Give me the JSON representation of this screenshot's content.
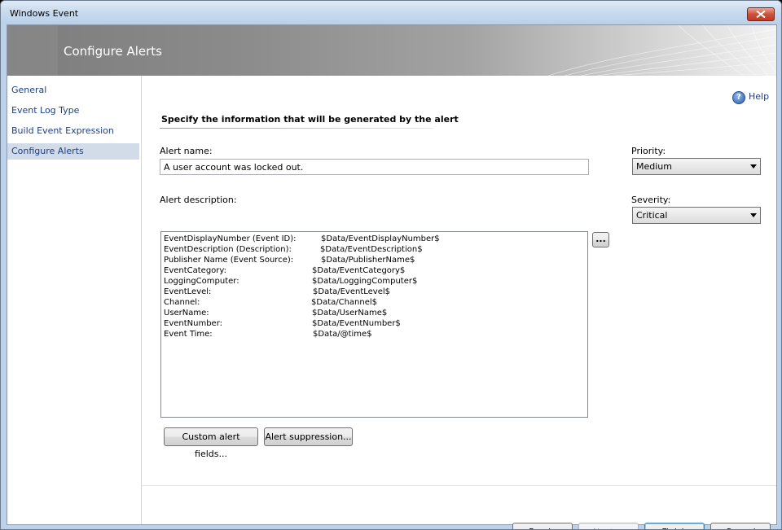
{
  "window": {
    "title": "Windows Event"
  },
  "banner": {
    "title": "Configure Alerts"
  },
  "nav": {
    "items": [
      {
        "label": "General"
      },
      {
        "label": "Event Log Type"
      },
      {
        "label": "Build Event Expression"
      },
      {
        "label": "Configure Alerts",
        "selected": true
      }
    ]
  },
  "help": {
    "label": "Help",
    "icon": "help-question-icon"
  },
  "section": {
    "heading": "Specify the information that will be generated by the alert"
  },
  "alert_name": {
    "label": "Alert name:",
    "value": "A user account was locked out."
  },
  "alert_description": {
    "label": "Alert description:",
    "browse_label": "...",
    "rows": [
      {
        "key": "EventDisplayNumber (Event ID):",
        "value": "$Data/EventDisplayNumber$"
      },
      {
        "key": "EventDescription (Description):",
        "value": "$Data/EventDescription$"
      },
      {
        "key": "Publisher Name (Event Source):",
        "value": "$Data/PublisherName$"
      },
      {
        "key": "EventCategory:",
        "value": "$Data/EventCategory$"
      },
      {
        "key": "LoggingComputer:",
        "value": "$Data/LoggingComputer$"
      },
      {
        "key": "EventLevel:",
        "value": "$Data/EventLevel$"
      },
      {
        "key": "Channel:",
        "value": "$Data/Channel$"
      },
      {
        "key": "UserName:",
        "value": "$Data/UserName$"
      },
      {
        "key": "EventNumber:",
        "value": "$Data/EventNumber$"
      },
      {
        "key": "Event Time:",
        "value": "$Data/@time$"
      }
    ]
  },
  "priority": {
    "label": "Priority:",
    "value": "Medium"
  },
  "severity": {
    "label": "Severity:",
    "value": "Critical"
  },
  "buttons": {
    "custom_fields": "Custom alert fields...",
    "suppression": "Alert suppression...",
    "previous": "< Previous",
    "next": "Next >",
    "finish": "Finish",
    "cancel": "Cancel"
  },
  "colors": {
    "titlebar": "#cadbee",
    "nav_selected": "#d2dbe8",
    "link": "#1a3f84",
    "close": "#c03a22"
  }
}
